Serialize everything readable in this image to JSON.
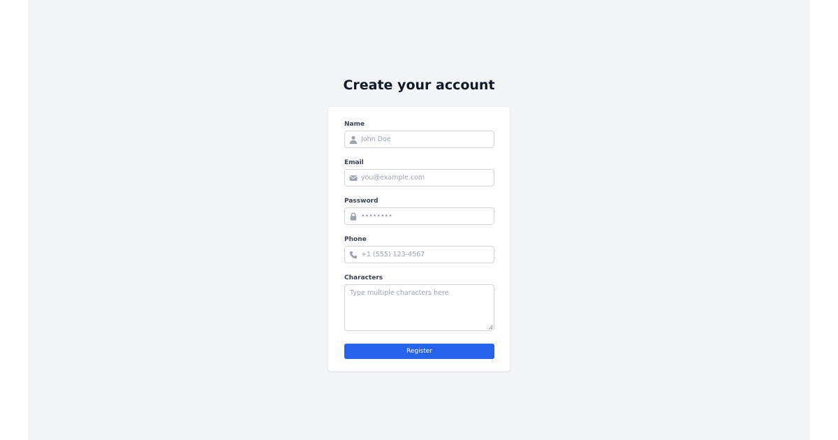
{
  "page": {
    "title": "Create your account"
  },
  "form": {
    "name": {
      "label": "Name",
      "placeholder": "John Doe",
      "value": "",
      "icon": "user-icon"
    },
    "email": {
      "label": "Email",
      "placeholder": "you@example.com",
      "value": "",
      "icon": "envelope-icon"
    },
    "password": {
      "label": "Password",
      "placeholder": "••••••••",
      "value": "",
      "icon": "lock-icon"
    },
    "phone": {
      "label": "Phone",
      "placeholder": "+1 (555) 123-4567",
      "value": "",
      "icon": "phone-icon"
    },
    "characters": {
      "label": "Characters",
      "placeholder": "Type multiple characters here",
      "value": ""
    },
    "submit_label": "Register"
  },
  "colors": {
    "page_background": "#f3f4f6",
    "card_background": "#ffffff",
    "primary_button": "#2563eb",
    "heading_text": "#111827",
    "label_text": "#374151",
    "placeholder_text": "#9ca3af",
    "icon": "#9ca3af",
    "input_border": "#d1d5db"
  }
}
